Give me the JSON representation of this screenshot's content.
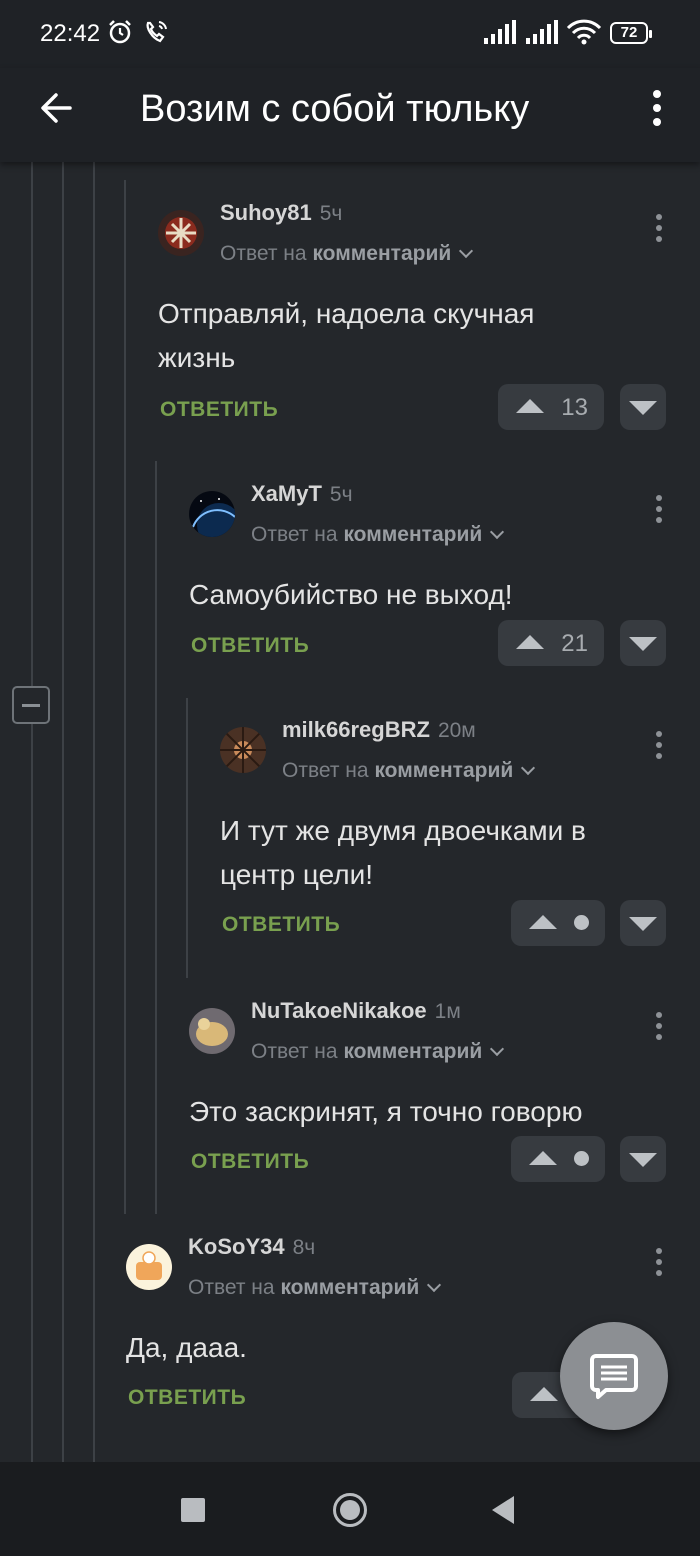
{
  "status_bar": {
    "time": "22:42",
    "battery": "72"
  },
  "app_bar": {
    "title": "Возим с собой тюльку"
  },
  "comments": [
    {
      "author": "Suhoy81",
      "age": "5ч",
      "reply_prefix": "Ответ на",
      "reply_target": "комментарий",
      "text_lines": [
        "Отправляй, надоела скучная",
        "жизнь"
      ],
      "reply_label": "ОТВЕТИТЬ",
      "votes": "13"
    },
    {
      "author": "XaMyT",
      "age": "5ч",
      "reply_prefix": "Ответ на",
      "reply_target": "комментарий",
      "text_lines": [
        "Самоубийство не выход!"
      ],
      "reply_label": "ОТВЕТИТЬ",
      "votes": "21"
    },
    {
      "author": "milk66regBRZ",
      "age": "20м",
      "reply_prefix": "Ответ на",
      "reply_target": "комментарий",
      "text_lines": [
        "И тут же двумя двоечками в",
        "центр цели!"
      ],
      "reply_label": "ОТВЕТИТЬ",
      "votes": ""
    },
    {
      "author": "NuTakoeNikakoe",
      "age": "1м",
      "reply_prefix": "Ответ на",
      "reply_target": "комментарий",
      "text_lines": [
        "Это заскринят, я точно говорю"
      ],
      "reply_label": "ОТВЕТИТЬ",
      "votes": ""
    },
    {
      "author": "KoSoY34",
      "age": "8ч",
      "reply_prefix": "Ответ на",
      "reply_target": "комментарий",
      "text_lines": [
        "Да, дааа."
      ],
      "reply_label": "ОТВЕТИТЬ",
      "votes": ""
    }
  ],
  "colors": {
    "background": "#24272b",
    "bar": "#1f2226",
    "reply_accent": "#79a04f",
    "thread_line": "#3d4146"
  },
  "icons": [
    "alarm-icon",
    "wifi-call-icon",
    "signal-icon",
    "wifi-icon",
    "battery-icon",
    "back-arrow-icon",
    "more-vert-icon",
    "collapse-thread-icon",
    "chevron-down-icon",
    "upvote-icon",
    "downvote-icon",
    "comment-fab-icon",
    "nav-recents-icon",
    "nav-home-icon",
    "nav-back-icon"
  ]
}
